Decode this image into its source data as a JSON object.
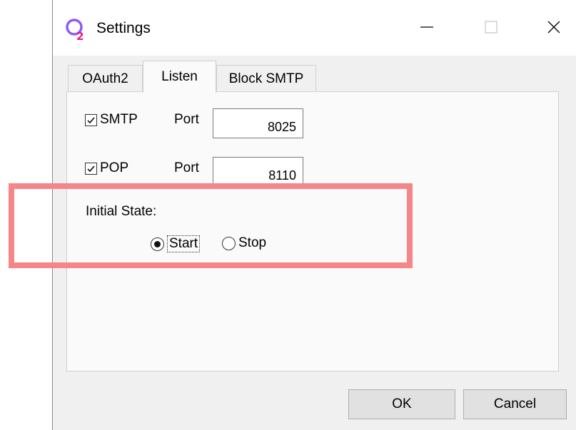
{
  "window": {
    "title": "Settings",
    "app_icon": "q2-app-icon",
    "controls": {
      "minimize": "minimize-icon",
      "maximize": "maximize-icon",
      "close": "close-icon"
    }
  },
  "tabs": [
    {
      "label": "OAuth2",
      "active": false
    },
    {
      "label": "Listen",
      "active": true
    },
    {
      "label": "Block SMTP",
      "active": false
    }
  ],
  "listen": {
    "smtp": {
      "label": "SMTP",
      "checked": true,
      "port_label": "Port",
      "port_value": "8025"
    },
    "pop": {
      "label": "POP",
      "checked": true,
      "port_label": "Port",
      "port_value": "8110"
    },
    "initial_state": {
      "label": "Initial State:",
      "options": [
        {
          "label": "Start",
          "selected": true
        },
        {
          "label": "Stop",
          "selected": false
        }
      ]
    }
  },
  "buttons": {
    "ok": "OK",
    "cancel": "Cancel"
  },
  "colors": {
    "highlight": "#f68587",
    "app_icon_purple": "#8b5cf6",
    "app_icon_pink": "#e11d8a"
  }
}
